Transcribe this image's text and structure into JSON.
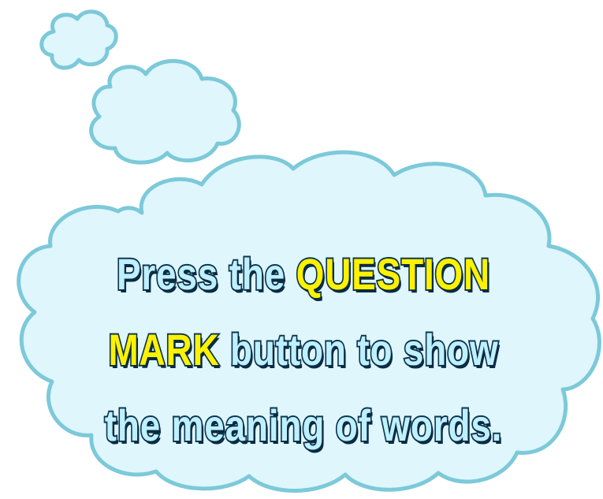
{
  "hint": {
    "line1": {
      "before": "Press the ",
      "highlight": "QUESTION"
    },
    "line2": {
      "highlight": "MARK",
      "after": " button to show"
    },
    "line3": {
      "text": "the meaning of words."
    }
  },
  "colors": {
    "cloud_fill": "#dff6fd",
    "cloud_outline": "#7cc9d9",
    "text_fill": "#bff0ff",
    "text_outline": "#0d3550",
    "highlight": "#fff200"
  }
}
